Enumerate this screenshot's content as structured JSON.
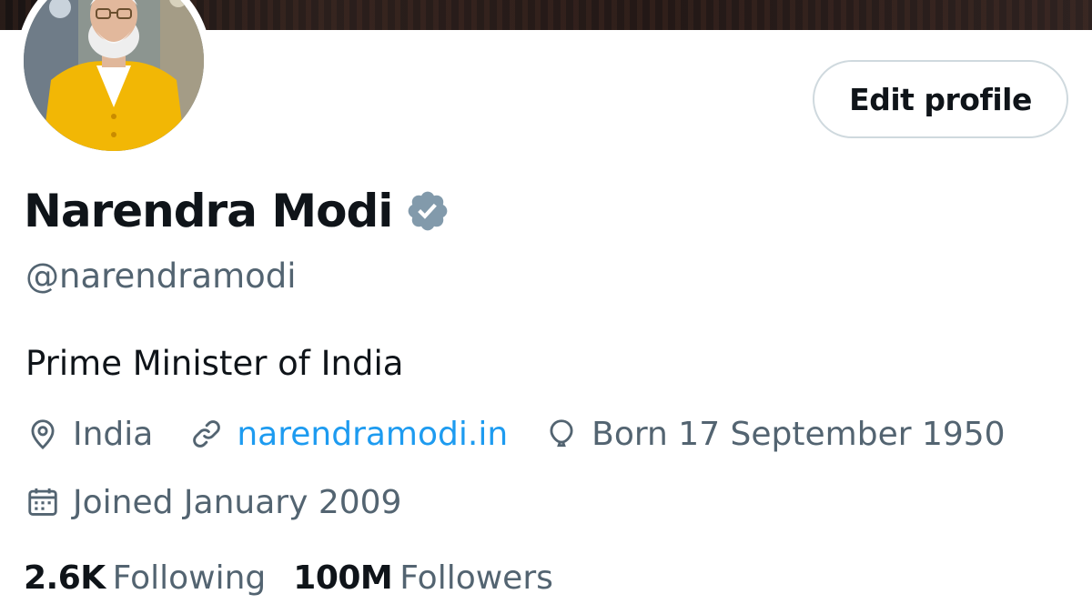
{
  "profile": {
    "name": "Narendra Modi",
    "handle": "@narendramodi",
    "bio": "Prime Minister of India",
    "verified": true,
    "avatar": {
      "alt": "Narendra Modi profile photo"
    }
  },
  "actions": {
    "edit_profile_label": "Edit profile"
  },
  "meta": {
    "location": "India",
    "website": "narendramodi.in",
    "birthday": "Born 17 September 1950",
    "joined": "Joined January 2009"
  },
  "stats": {
    "following_count": "2.6K",
    "following_label": "Following",
    "followers_count": "100M",
    "followers_label": "Followers"
  },
  "icons": {
    "verified": "verified-badge-icon",
    "location": "location-pin-icon",
    "link": "link-icon",
    "birthday": "balloon-icon",
    "joined": "calendar-icon"
  },
  "colors": {
    "text_primary": "#0f1419",
    "text_secondary": "#536471",
    "link": "#1d9bf0",
    "verified_badge": "#829aab",
    "button_border": "#cfd9de"
  }
}
